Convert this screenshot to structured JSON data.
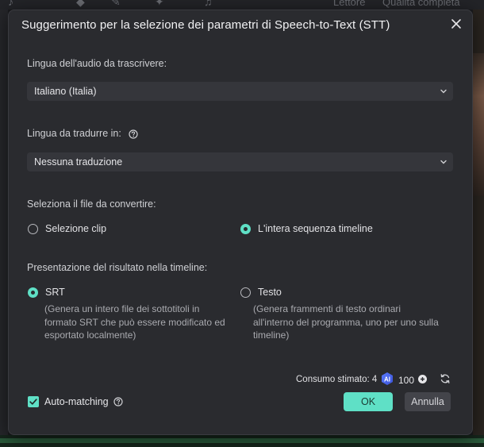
{
  "background": {
    "top_text_1": "Lettore",
    "top_text_2": "Qualità completa"
  },
  "dialog": {
    "title": "Suggerimento per la selezione dei parametri di Speech-to-Text (STT)",
    "close_icon": "close-icon"
  },
  "audio_language": {
    "label": "Lingua dell'audio da trascrivere:",
    "value": "Italiano (Italia)"
  },
  "translate_language": {
    "label": "Lingua da tradurre in:",
    "value": "Nessuna traduzione",
    "help_icon": "help-circle-icon"
  },
  "source_file": {
    "label": "Seleziona il file da convertire:",
    "options": [
      {
        "label": "Selezione clip",
        "selected": false
      },
      {
        "label": "L'intera sequenza timeline",
        "selected": true
      }
    ]
  },
  "output": {
    "label": "Presentazione del risultato nella timeline:",
    "options": [
      {
        "label": "SRT",
        "selected": true,
        "desc": [
          "(Genera un intero file dei sottotitoli in",
          "formato SRT che può essere modificato ed",
          "esportato localmente)"
        ]
      },
      {
        "label": "Testo",
        "selected": false,
        "desc": [
          "(Genera frammenti di testo ordinari",
          "all'interno del programma, uno per uno sulla",
          "timeline)"
        ]
      }
    ]
  },
  "footer": {
    "consumo_label": "Consumo stimato: 4",
    "ai_badge": "AI",
    "credits": "100",
    "auto_matching": "Auto-matching",
    "auto_matching_checked": true,
    "ok": "OK",
    "cancel": "Annulla"
  },
  "colors": {
    "accent": "#5fe0c6",
    "dialog_bg": "#2a2b2f",
    "field_bg": "#35363b"
  }
}
